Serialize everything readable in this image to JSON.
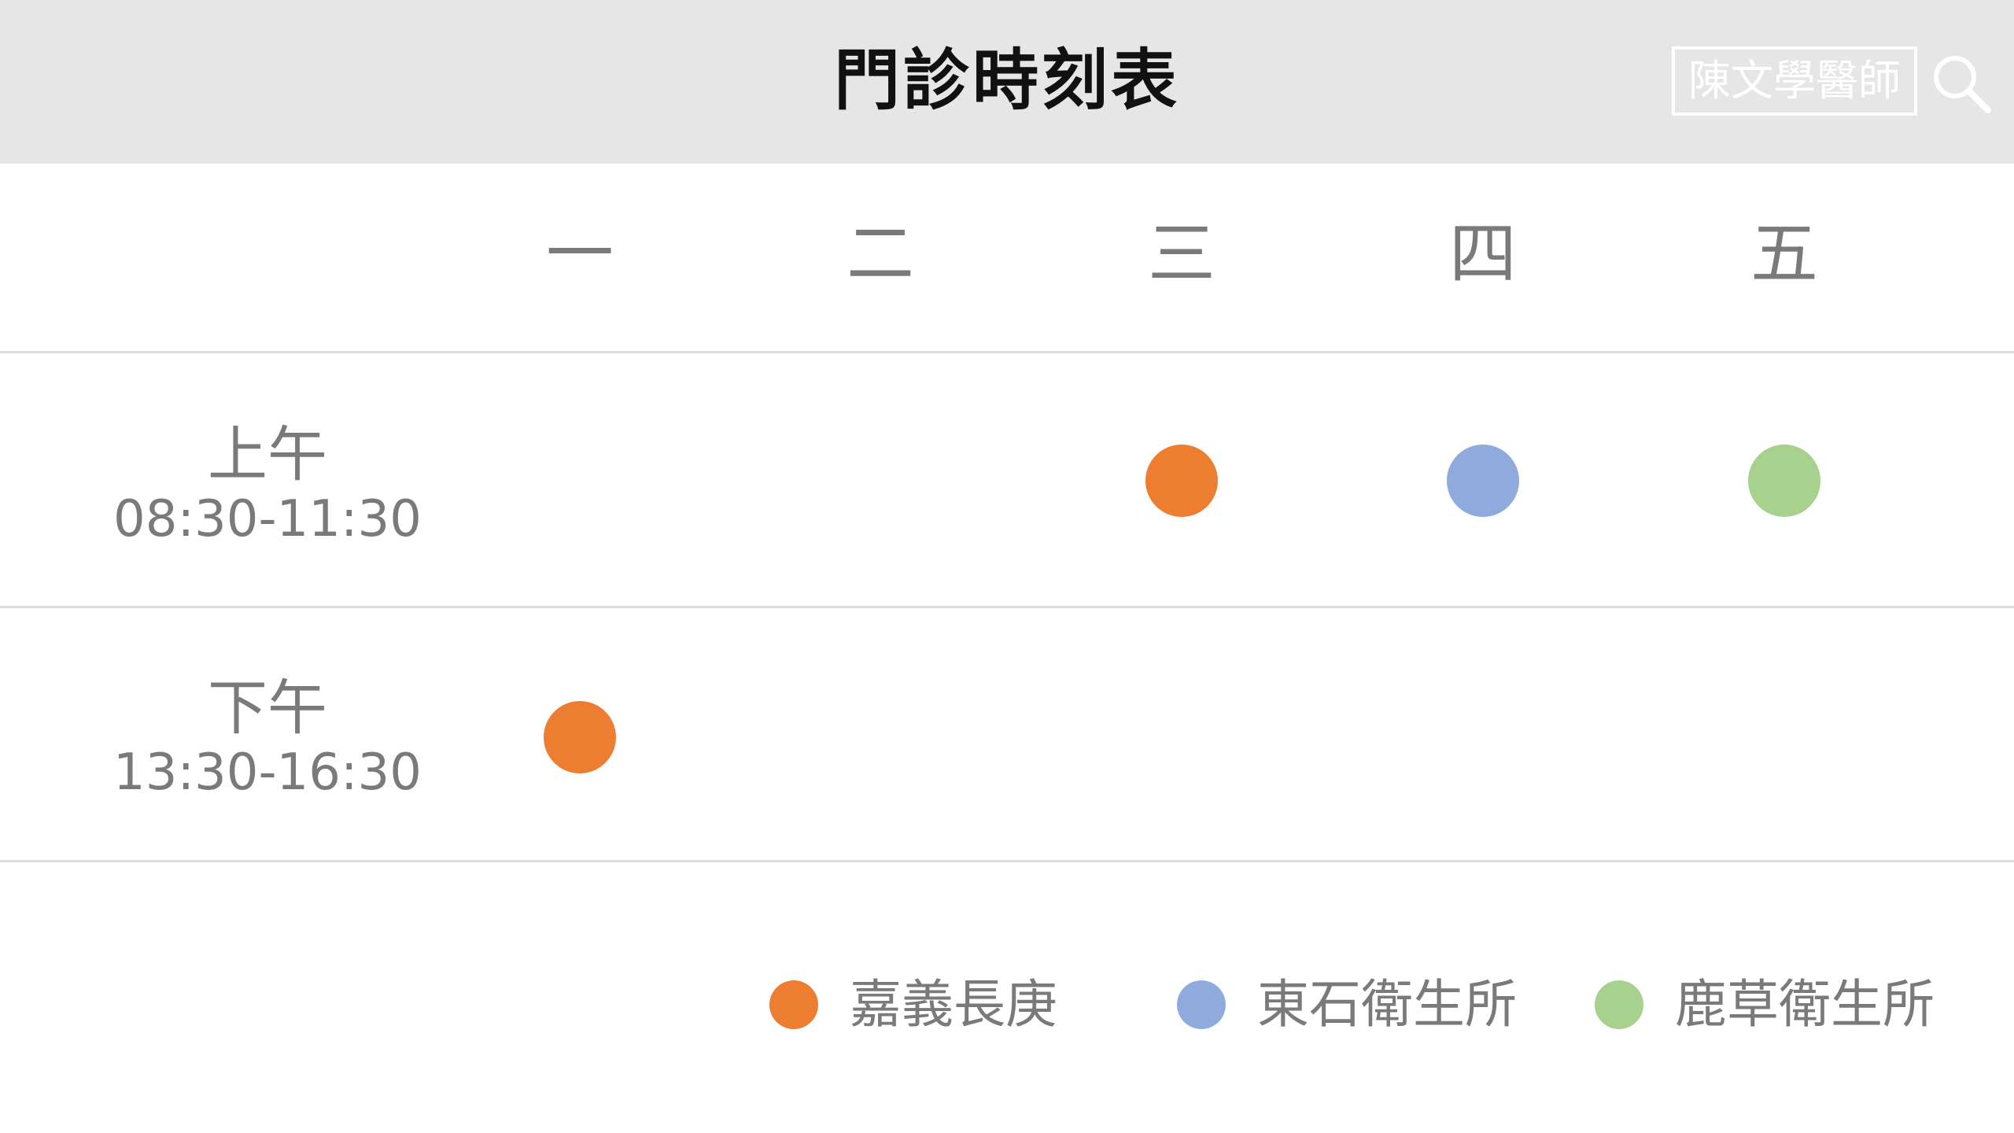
{
  "header": {
    "title": "門診時刻表",
    "doctor_label": "陳文學醫師",
    "search_icon": "search-icon"
  },
  "days": [
    "一",
    "二",
    "三",
    "四",
    "五"
  ],
  "slots": [
    {
      "name": "上午",
      "time": "08:30-11:30"
    },
    {
      "name": "下午",
      "time": "13:30-16:30"
    }
  ],
  "clinics": [
    {
      "name": "嘉義長庚",
      "color": "#ed7d31"
    },
    {
      "name": "東石衛生所",
      "color": "#8faadc"
    },
    {
      "name": "鹿草衛生所",
      "color": "#a9d18e"
    }
  ],
  "schedule": [
    {
      "slot": 0,
      "day": 2,
      "clinic": 0
    },
    {
      "slot": 0,
      "day": 3,
      "clinic": 1
    },
    {
      "slot": 0,
      "day": 4,
      "clinic": 2
    },
    {
      "slot": 1,
      "day": 0,
      "clinic": 0
    }
  ]
}
